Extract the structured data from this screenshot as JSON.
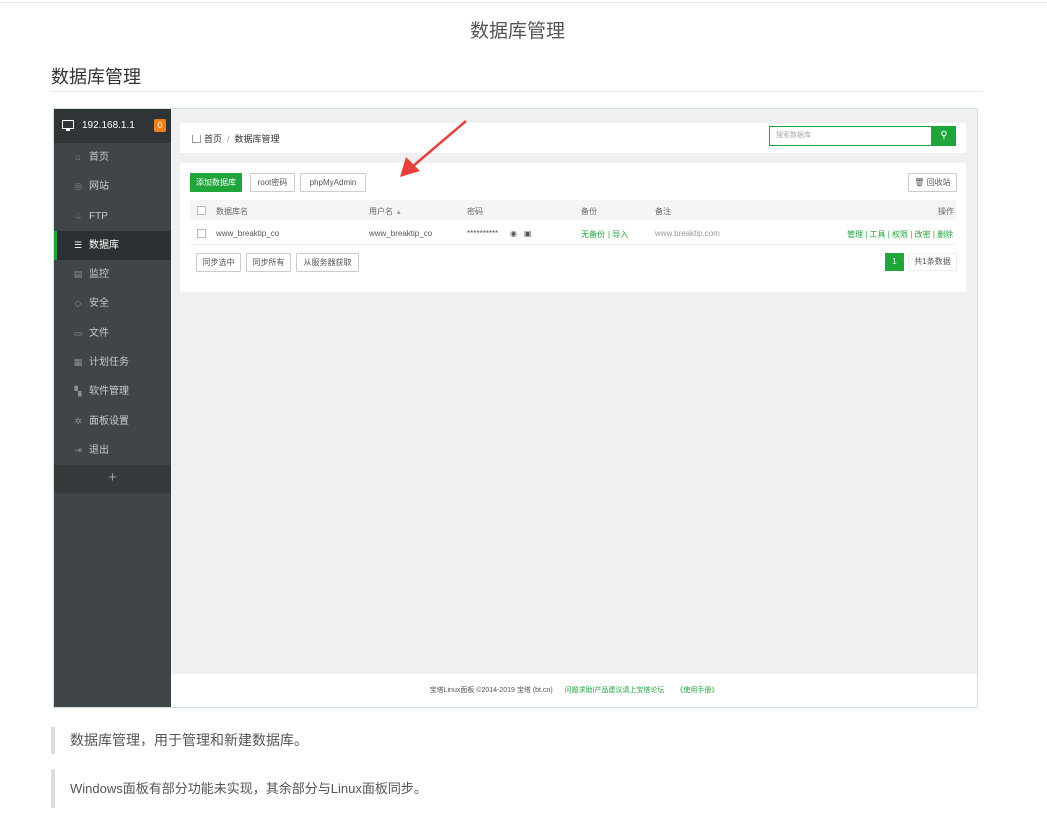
{
  "page": {
    "title": "数据库管理",
    "section_heading": "数据库管理"
  },
  "screenshot": {
    "sidebar": {
      "ip": "192.168.1.1",
      "badge": "0",
      "items": [
        {
          "label": "首页",
          "icon": "home-icon"
        },
        {
          "label": "网站",
          "icon": "globe-icon"
        },
        {
          "label": "FTP",
          "icon": "ftp-icon"
        },
        {
          "label": "数据库",
          "icon": "database-icon",
          "active": true
        },
        {
          "label": "监控",
          "icon": "monitor-icon"
        },
        {
          "label": "安全",
          "icon": "shield-icon"
        },
        {
          "label": "文件",
          "icon": "folder-icon"
        },
        {
          "label": "计划任务",
          "icon": "calendar-icon"
        },
        {
          "label": "软件管理",
          "icon": "grid-icon"
        },
        {
          "label": "面板设置",
          "icon": "gear-icon"
        },
        {
          "label": "退出",
          "icon": "logout-icon"
        }
      ],
      "add": "+"
    },
    "breadcrumb": {
      "home": "首页",
      "sep": "/",
      "current": "数据库管理"
    },
    "search": {
      "placeholder": "搜索数据库",
      "icon": "search-icon"
    },
    "toolbar": {
      "add_db": "添加数据库",
      "root_pwd": "root密码",
      "phpmyadmin": "phpMyAdmin",
      "recycle": "回收站"
    },
    "table": {
      "headers": {
        "name": "数据库名",
        "user": "用户名",
        "user_sort": "▲",
        "password": "密码",
        "backup": "备份",
        "note": "备注",
        "ops": "操作"
      },
      "rows": [
        {
          "name": "www_breaktip_co",
          "user": "www_breaktip_co",
          "password": "**********",
          "backup": "无备份",
          "import": "导入",
          "note": "www.breaktip.com",
          "ops": [
            "管理",
            "工具",
            "权限",
            "改密",
            "删除"
          ]
        }
      ]
    },
    "bottom_buttons": {
      "sync_selected": "同步选中",
      "sync_all": "同步所有",
      "from_server": "从服务器获取"
    },
    "pagination": {
      "current": "1",
      "total": "共1条数据"
    },
    "footer": {
      "copyright": "宝塔Linux面板 ©2014-2019 宝塔 (bt.cn)",
      "forum": "问题求助|产品建议请上宝塔论坛",
      "manual": "《使用手册》"
    },
    "colors": {
      "accent": "#20a53a",
      "sidebar": "#3f4549",
      "badge": "#f0811d",
      "arrow": "#e8403a"
    }
  },
  "notes": [
    "数据库管理，用于管理和新建数据库。",
    "Windows面板有部分功能未实现，其余部分与Linux面板同步。"
  ]
}
